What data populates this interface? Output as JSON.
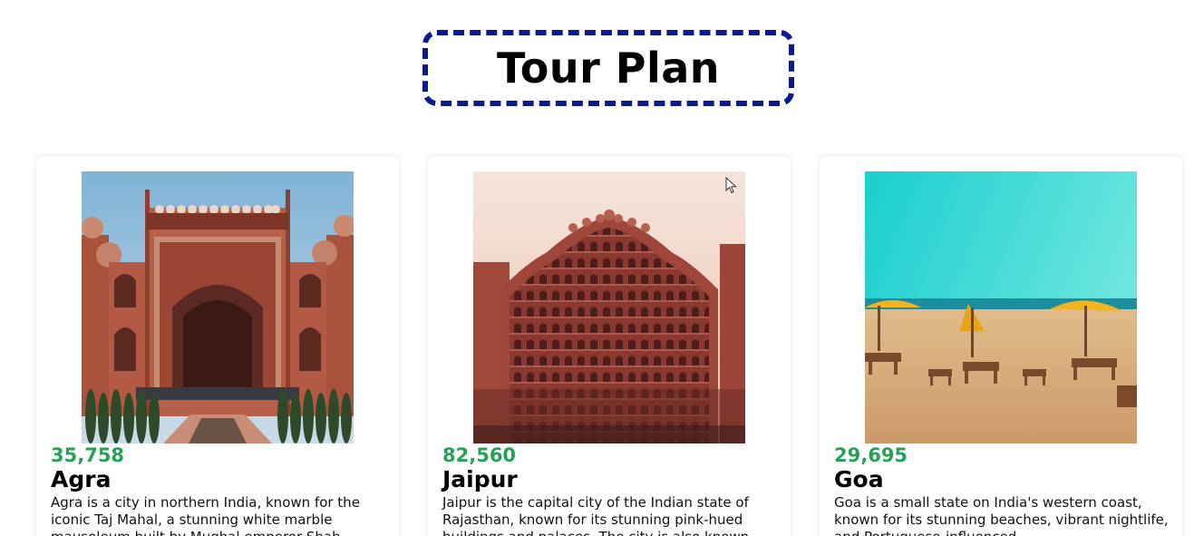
{
  "page": {
    "title": "Tour Plan"
  },
  "cards": [
    {
      "price": "35,758",
      "name": "Agra",
      "description": "Agra is a city in northern India, known for the iconic Taj Mahal, a stunning white marble mausoleum built by Mughal emperor Shah",
      "image_icon": "red-fort-gate-photo"
    },
    {
      "price": "82,560",
      "name": "Jaipur",
      "description": "Jaipur is the capital city of the Indian state of Rajasthan, known for its stunning pink-hued buildings and palaces. The city is also known",
      "image_icon": "hawa-mahal-photo"
    },
    {
      "price": "29,695",
      "name": "Goa",
      "description": "Goa is a small state on India's western coast, known for its stunning beaches, vibrant nightlife, and Portuguese-influenced",
      "image_icon": "beach-umbrellas-photo"
    }
  ],
  "colors": {
    "title_border": "#0a1a8c",
    "price": "#27a155"
  }
}
